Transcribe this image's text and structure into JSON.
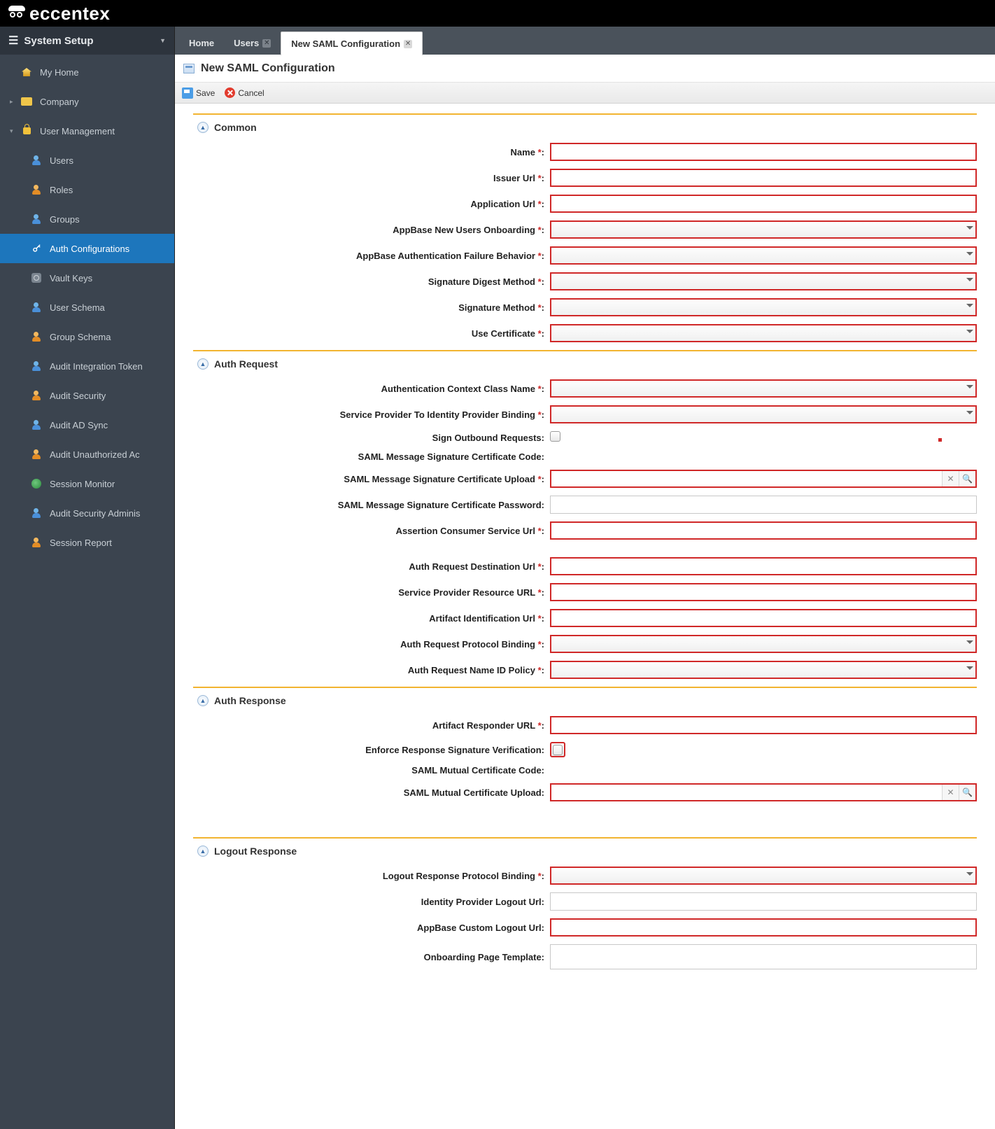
{
  "brand": "eccentex",
  "sidebar": {
    "header": "System Setup",
    "top": [
      {
        "label": "My Home",
        "icon": "home"
      },
      {
        "label": "Company",
        "icon": "folder",
        "expandable": true
      },
      {
        "label": "User Management",
        "icon": "lock",
        "expanded": true
      }
    ],
    "userMgmt": [
      {
        "label": "Users",
        "icon": "user"
      },
      {
        "label": "Roles",
        "icon": "user"
      },
      {
        "label": "Groups",
        "icon": "user"
      },
      {
        "label": "Auth Configurations",
        "icon": "key",
        "active": true
      },
      {
        "label": "Vault Keys",
        "icon": "vault"
      },
      {
        "label": "User Schema",
        "icon": "user"
      },
      {
        "label": "Group Schema",
        "icon": "user"
      },
      {
        "label": "Audit Integration Token",
        "icon": "user"
      },
      {
        "label": "Audit Security",
        "icon": "user"
      },
      {
        "label": "Audit AD Sync",
        "icon": "user"
      },
      {
        "label": "Audit Unauthorized Ac",
        "icon": "user"
      },
      {
        "label": "Session Monitor",
        "icon": "session"
      },
      {
        "label": "Audit Security Adminis",
        "icon": "user"
      },
      {
        "label": "Session Report",
        "icon": "user"
      }
    ]
  },
  "tabs": [
    {
      "label": "Home"
    },
    {
      "label": "Users",
      "closable": true
    },
    {
      "label": "New SAML Configuration",
      "closable": true,
      "active": true
    }
  ],
  "page": {
    "title": "New SAML Configuration"
  },
  "toolbar": {
    "save": "Save",
    "cancel": "Cancel"
  },
  "sections": {
    "common": {
      "title": "Common",
      "fields": {
        "name": "Name",
        "issuer": "Issuer Url",
        "appurl": "Application Url",
        "onboard": "AppBase New Users Onboarding",
        "authfail": "AppBase Authentication Failure Behavior",
        "digest": "Signature Digest Method",
        "sigmethod": "Signature Method",
        "usecert": "Use Certificate"
      }
    },
    "request": {
      "title": "Auth Request",
      "fields": {
        "ctxclass": "Authentication Context Class Name",
        "spidp": "Service Provider To Identity Provider Binding",
        "signout": "Sign Outbound Requests:",
        "sigcertcode": "SAML Message Signature Certificate Code:",
        "sigcertup": "SAML Message Signature Certificate Upload",
        "sigcertpwd": "SAML Message Signature Certificate Password:",
        "acsurl": "Assertion Consumer Service Url",
        "desturl": "Auth Request Destination Url",
        "spresurl": "Service Provider Resource URL",
        "artifacturl": "Artifact Identification Url",
        "protobind": "Auth Request Protocol Binding",
        "nameidp": "Auth Request Name ID Policy"
      }
    },
    "response": {
      "title": "Auth Response",
      "fields": {
        "artresp": "Artifact Responder URL",
        "enforce": "Enforce Response Signature Verification:",
        "mutcertcode": "SAML Mutual Certificate Code:",
        "mutcertup": "SAML Mutual Certificate Upload:"
      }
    },
    "logout": {
      "title": "Logout Response",
      "fields": {
        "logoutproto": "Logout Response Protocol Binding",
        "idplogout": "Identity Provider Logout Url:",
        "customlogout": "AppBase Custom Logout Url:",
        "onboardtpl": "Onboarding Page Template:"
      }
    }
  }
}
